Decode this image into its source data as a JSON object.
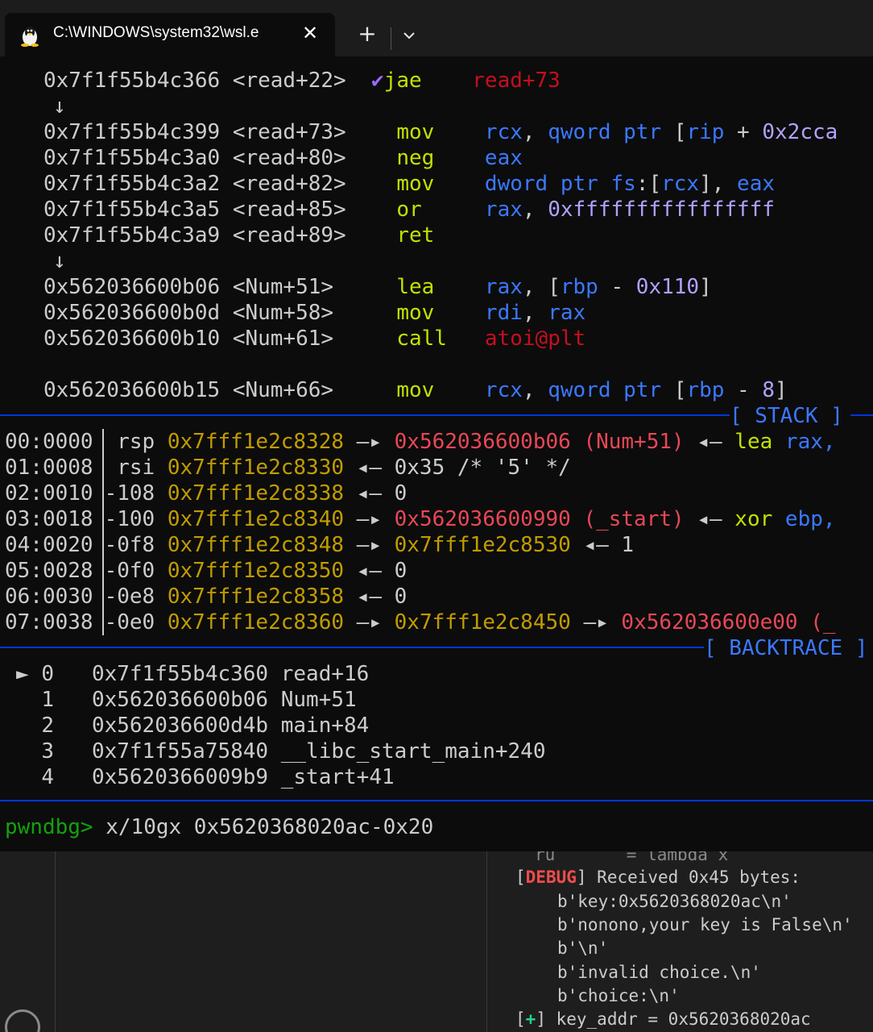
{
  "window": {
    "tab_title": "C:\\WINDOWS\\system32\\wsl.e",
    "close_glyph": "✕",
    "new_tab_glyph": "+",
    "dropdown_icon": "chevron-down-icon",
    "tab_icon": "tux-linux-icon"
  },
  "disasm": [
    {
      "addr": "0x7f1f55b4c366",
      "sym": "<read+22>",
      "mark": "✔",
      "op": "jae",
      "args": "read+73"
    },
    {
      "arrow": "↓"
    },
    {
      "addr": "0x7f1f55b4c399",
      "sym": "<read+73>",
      "op": "mov",
      "a1": "rcx",
      "a2": "qword",
      "a3": "ptr",
      "a4": "rip",
      "a5": "0x2cca"
    },
    {
      "addr": "0x7f1f55b4c3a0",
      "sym": "<read+80>",
      "op": "neg",
      "a1": "eax"
    },
    {
      "addr": "0x7f1f55b4c3a2",
      "sym": "<read+82>",
      "op": "mov",
      "a1": "dword",
      "a2": "ptr",
      "a3": "fs",
      "a4": "rcx",
      "a5": "eax"
    },
    {
      "addr": "0x7f1f55b4c3a5",
      "sym": "<read+85>",
      "op": "or",
      "a1": "rax",
      "a2": "0xffffffffffffffff"
    },
    {
      "addr": "0x7f1f55b4c3a9",
      "sym": "<read+89>",
      "op": "ret"
    },
    {
      "arrow": "↓"
    },
    {
      "addr": "0x562036600b06",
      "sym": "<Num+51>",
      "op": "lea",
      "a1": "rax",
      "a2": "rbp",
      "a3": "0x110"
    },
    {
      "addr": "0x562036600b0d",
      "sym": "<Num+58>",
      "op": "mov",
      "a1": "rdi",
      "a2": "rax"
    },
    {
      "addr": "0x562036600b10",
      "sym": "<Num+61>",
      "op": "call",
      "a1": "atoi@plt"
    },
    {
      "addr": "0x562036600b15",
      "sym": "<Num+66>",
      "op": "mov",
      "a1": "rcx",
      "a2": "qword",
      "a3": "ptr",
      "a4": "rbp",
      "a5": "8"
    }
  ],
  "stack_header": "[ STACK ]",
  "stack": [
    {
      "idx": "00:0000",
      "reg": " rsp",
      "addr": "0x7fff1e2c8328",
      "tail": [
        {
          "t": " —▸ ",
          "c": "w"
        },
        {
          "t": "0x562036600b06 (Num+51)",
          "c": "r"
        },
        {
          "t": " ◂— ",
          "c": "w"
        },
        {
          "t": "lea",
          "c": "g"
        },
        {
          "t": " rax,",
          "c": "b"
        }
      ]
    },
    {
      "idx": "01:0008",
      "reg": " rsi",
      "addr": "0x7fff1e2c8330",
      "tail": [
        {
          "t": " ◂— 0x35 /* '5' */",
          "c": "w"
        }
      ]
    },
    {
      "idx": "02:0010",
      "reg": "-108",
      "addr": "0x7fff1e2c8338",
      "tail": [
        {
          "t": " ◂— 0",
          "c": "w"
        }
      ]
    },
    {
      "idx": "03:0018",
      "reg": "-100",
      "addr": "0x7fff1e2c8340",
      "tail": [
        {
          "t": " —▸ ",
          "c": "w"
        },
        {
          "t": "0x562036600990 (_start)",
          "c": "r"
        },
        {
          "t": " ◂— ",
          "c": "w"
        },
        {
          "t": "xor",
          "c": "g"
        },
        {
          "t": " ebp,",
          "c": "b"
        }
      ]
    },
    {
      "idx": "04:0020",
      "reg": "-0f8",
      "addr": "0x7fff1e2c8348",
      "tail": [
        {
          "t": " —▸ ",
          "c": "w"
        },
        {
          "t": "0x7fff1e2c8530",
          "c": "y"
        },
        {
          "t": " ◂— 1",
          "c": "w"
        }
      ]
    },
    {
      "idx": "05:0028",
      "reg": "-0f0",
      "addr": "0x7fff1e2c8350",
      "tail": [
        {
          "t": " ◂— 0",
          "c": "w"
        }
      ]
    },
    {
      "idx": "06:0030",
      "reg": "-0e8",
      "addr": "0x7fff1e2c8358",
      "tail": [
        {
          "t": " ◂— 0",
          "c": "w"
        }
      ]
    },
    {
      "idx": "07:0038",
      "reg": "-0e0",
      "addr": "0x7fff1e2c8360",
      "tail": [
        {
          "t": " —▸ ",
          "c": "w"
        },
        {
          "t": "0x7fff1e2c8450",
          "c": "y"
        },
        {
          "t": " —▸ ",
          "c": "w"
        },
        {
          "t": "0x562036600e00 (_",
          "c": "r"
        }
      ]
    }
  ],
  "backtrace_header": "[ BACKTRACE ]",
  "backtrace": [
    {
      "mark": "►",
      "n": "0",
      "addr": "0x7f1f55b4c360",
      "sym": "read+16"
    },
    {
      "mark": " ",
      "n": "1",
      "addr": "0x562036600b06",
      "sym": "Num+51"
    },
    {
      "mark": " ",
      "n": "2",
      "addr": "0x562036600d4b",
      "sym": "main+84"
    },
    {
      "mark": " ",
      "n": "3",
      "addr": "0x7f1f55a75840",
      "sym": "__libc_start_main+240"
    },
    {
      "mark": " ",
      "n": "4",
      "addr": "0x5620366009b9",
      "sym": "_start+41"
    }
  ],
  "prompt": {
    "label": "pwndbg>",
    "command": " x/10gx 0x5620368020ac-0x20"
  },
  "output": {
    "partial_line": "ru       = lambda x",
    "debug_tag": "DEBUG",
    "debug_msg": " Received 0x45 bytes:",
    "lines": [
      "b'key:0x5620368020ac\\n'",
      "b'nonono,your key is False\\n'",
      "b'\\n'",
      "b'invalid choice.\\n'",
      "b'choice:\\n'"
    ],
    "plus_tag": "+",
    "key_line": " key_addr = 0x5620368020ac"
  },
  "colors": {
    "background": "#0c0c0c",
    "address_yellow": "#c19c00",
    "symbol_red": "#e74856",
    "opcode_green": "#c3e000",
    "register_blue": "#3b78ff",
    "immediate_purple": "#b4a0ff",
    "separator_blue": "#0037da",
    "prompt_green": "#13a10e"
  }
}
